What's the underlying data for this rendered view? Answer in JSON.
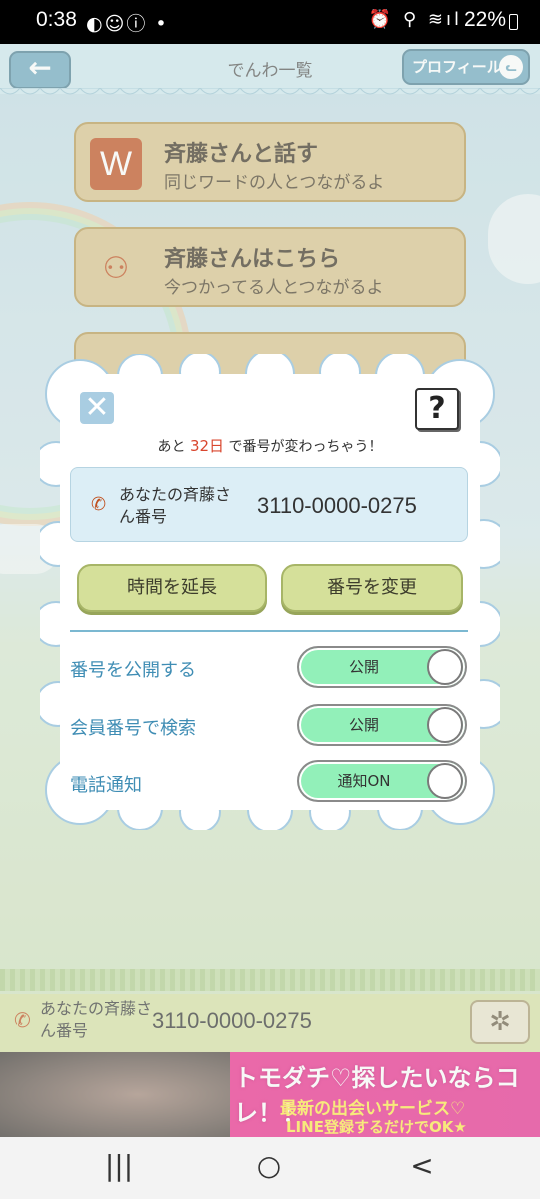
{
  "status_bar": {
    "time": "0:38",
    "left_icons": "◐☺ⓘ •",
    "right_icons": "⏰ ⚲ ≋ıl",
    "battery": "22%"
  },
  "header": {
    "back_icon": "←",
    "title": "でんわ一覧",
    "profile_label": "プロフィール",
    "profile_icon": "cat-icon"
  },
  "menu": [
    {
      "title": "斉藤さんと話す",
      "subtitle": "同じワードの人とつながるよ",
      "icon": "W"
    },
    {
      "title": "斉藤さんはこちら",
      "subtitle": "今つかってる人とつながるよ",
      "icon": "people-search-icon"
    }
  ],
  "dialog": {
    "close_icon": "✕",
    "help_icon": "?",
    "countdown_prefix": "あと",
    "countdown_days": "32日",
    "countdown_suffix": "で番号が変わっちゃう！",
    "number_label": "あなたの斉藤さん番号",
    "number": "3110-0000-0275",
    "extend_button": "時間を延長",
    "change_button": "番号を変更",
    "settings": [
      {
        "label": "番号を公開する",
        "value": "公開"
      },
      {
        "label": "会員番号で検索",
        "value": "公開"
      },
      {
        "label": "電話通知",
        "value": "通知ON"
      }
    ]
  },
  "bottom_bar": {
    "label": "あなたの斉藤さん番号",
    "number": "3110-0000-0275",
    "gear_icon": "✲"
  },
  "ad": {
    "line1": "トモダチ♡探したいならコレ！！",
    "line2": "最新の出会いサービス♡",
    "line3": "LINE登録するだけでOK★"
  },
  "nav": {
    "recents": "|||",
    "home": "○",
    "back": "<"
  }
}
